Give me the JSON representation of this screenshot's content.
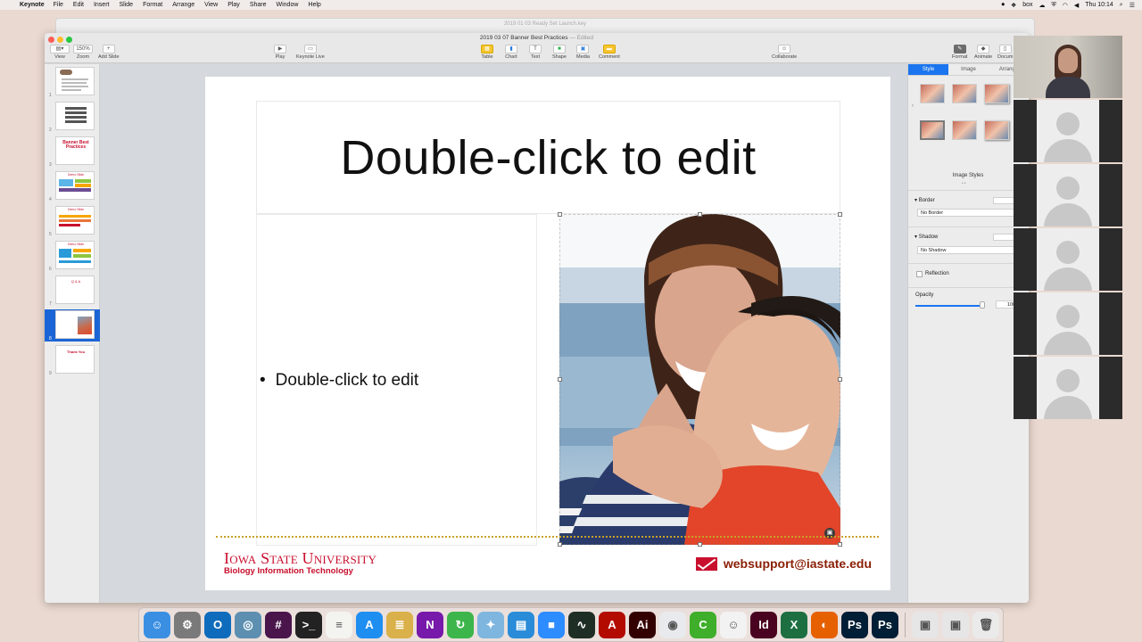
{
  "menubar": {
    "app_name": "Keynote",
    "menus": [
      "File",
      "Edit",
      "Insert",
      "Slide",
      "Format",
      "Arrange",
      "View",
      "Play",
      "Share",
      "Window",
      "Help"
    ],
    "status_box": "box",
    "clock": "Thu 10:14"
  },
  "background_window": {
    "title": "2019 01 03 Ready Set Launch.key"
  },
  "window": {
    "doc_title": "2019 03 07 Banner Best Practices",
    "doc_status": "— Edited",
    "toolbar": {
      "view_label": "View",
      "zoom_label": "Zoom",
      "zoom_value": "150%",
      "add_slide_label": "Add Slide",
      "play_label": "Play",
      "keynote_live_label": "Keynote Live",
      "table_label": "Table",
      "chart_label": "Chart",
      "text_label": "Text",
      "shape_label": "Shape",
      "media_label": "Media",
      "comment_label": "Comment",
      "collaborate_label": "Collaborate",
      "format_label": "Format",
      "animate_label": "Animate",
      "document_label": "Docum"
    }
  },
  "navigator": {
    "slides": [
      {
        "num": "1"
      },
      {
        "num": "2"
      },
      {
        "num": "3",
        "thumb_title": "Banner Best Practices"
      },
      {
        "num": "4",
        "thumb_title": "Demo Slide"
      },
      {
        "num": "5",
        "thumb_title": "Demo Slide"
      },
      {
        "num": "6",
        "thumb_title": "Demo Slide"
      },
      {
        "num": "7",
        "thumb_title": "Q & A"
      },
      {
        "num": "8",
        "selected": true
      },
      {
        "num": "9",
        "thumb_title": "Thank You"
      }
    ]
  },
  "slide": {
    "title": "Double-click to edit",
    "bullet_marker": "•",
    "bullet": "Double-click to edit",
    "footer_wordmark": "Iowa State University",
    "footer_subtitle": "Biology Information Technology",
    "contact_email": "websupport@iastate.edu",
    "accent_color": "#c8102e",
    "gold_color": "#c9a227"
  },
  "inspector": {
    "tabs": [
      "Style",
      "Image",
      "Arrange"
    ],
    "active_tab": "Style",
    "image_styles_label": "Image Styles",
    "border_label": "Border",
    "border_value": "No Border",
    "shadow_label": "Shadow",
    "shadow_value": "No Shadow",
    "reflection_label": "Reflection",
    "opacity_label": "Opacity",
    "opacity_value": "100%",
    "opacity_level": 1.0
  },
  "gallery": {
    "participants": [
      {
        "type": "live"
      },
      {
        "type": "placeholder"
      },
      {
        "type": "placeholder"
      },
      {
        "type": "placeholder"
      },
      {
        "type": "placeholder"
      },
      {
        "type": "placeholder"
      }
    ]
  },
  "dock": {
    "apps": [
      {
        "name": "finder-icon",
        "color": "#3a8fe3",
        "glyph": "☺"
      },
      {
        "name": "system-preferences-icon",
        "color": "#7a7a7a",
        "glyph": "⚙"
      },
      {
        "name": "outlook-icon",
        "color": "#0f6cbd",
        "glyph": "O"
      },
      {
        "name": "network-utility-icon",
        "color": "#5c8fb0",
        "glyph": "◎"
      },
      {
        "name": "slack-icon",
        "color": "#4a154b",
        "glyph": "#"
      },
      {
        "name": "terminal-icon",
        "color": "#222222",
        "glyph": ">_"
      },
      {
        "name": "notes-icon",
        "color": "#f3f3ef",
        "glyph": "≡"
      },
      {
        "name": "app-store-icon",
        "color": "#1f8ef1",
        "glyph": "A"
      },
      {
        "name": "sequel-database-icon",
        "color": "#d9b04a",
        "glyph": "≣"
      },
      {
        "name": "onenote-icon",
        "color": "#7719aa",
        "glyph": "N"
      },
      {
        "name": "sync-icon",
        "color": "#3cb54a",
        "glyph": "↻"
      },
      {
        "name": "toolbox-icon",
        "color": "#7fb6e0",
        "glyph": "✦"
      },
      {
        "name": "keynote-icon",
        "color": "#2a8cd8",
        "glyph": "▤"
      },
      {
        "name": "zoom-icon",
        "color": "#2d8cff",
        "glyph": "■"
      },
      {
        "name": "activity-monitor-icon",
        "color": "#1e2e24",
        "glyph": "∿"
      },
      {
        "name": "acrobat-icon",
        "color": "#b30b00",
        "glyph": "A"
      },
      {
        "name": "illustrator-icon",
        "color": "#330000",
        "glyph": "Ai"
      },
      {
        "name": "chrome-icon",
        "color": "#e8eaed",
        "glyph": "◉"
      },
      {
        "name": "camtasia-icon",
        "color": "#3fae2a",
        "glyph": "C"
      },
      {
        "name": "messages-icon",
        "color": "#f2f2f2",
        "glyph": "☺"
      },
      {
        "name": "indesign-icon",
        "color": "#49021f",
        "glyph": "Id"
      },
      {
        "name": "excel-icon",
        "color": "#1d6f42",
        "glyph": "X"
      },
      {
        "name": "firefox-icon",
        "color": "#e66000",
        "glyph": "◐"
      },
      {
        "name": "photoshop-icon",
        "color": "#001e36",
        "glyph": "Ps"
      },
      {
        "name": "photoshop-alt-icon",
        "color": "#001e36",
        "glyph": "Ps"
      }
    ],
    "after_sep": [
      {
        "name": "downloads-stack-icon",
        "color": "#e6e6e6",
        "glyph": "▣"
      },
      {
        "name": "documents-stack-icon",
        "color": "#e6e6e6",
        "glyph": "▣"
      },
      {
        "name": "trash-icon",
        "color": "#eaeaea",
        "glyph": "🗑"
      }
    ]
  }
}
